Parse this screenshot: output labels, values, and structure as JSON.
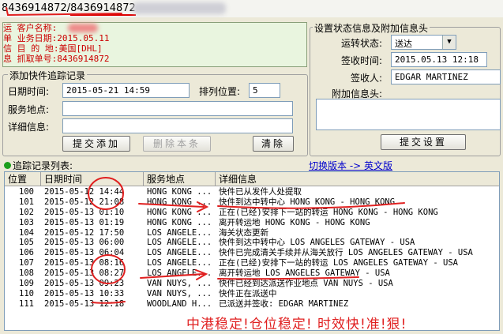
{
  "window": {
    "title_part1": "8436914872/",
    "title_part2": "8436914872"
  },
  "shipment_info": {
    "lines": [
      {
        "label": "运 客户名称:",
        "value": ""
      },
      {
        "label": "单 业务日期:",
        "value": "2015.05.11"
      },
      {
        "label": "信 目 的 地:",
        "value": "美国[DHL]"
      },
      {
        "label": "息 抓取单号:",
        "value": "8436914872"
      }
    ]
  },
  "add_record": {
    "group_title": "添加快件追踪记录",
    "date_label": "日期时间:",
    "date_value": "2015-05-21 14:59",
    "sort_label": "排列位置:",
    "sort_value": "5",
    "location_label": "服务地点:",
    "location_value": "",
    "detail_label": "详细信息:",
    "detail_value": "",
    "submit_button": "提交添加",
    "delete_button": "删除本条",
    "clear_button": "清除"
  },
  "status_panel": {
    "group_title": "设置状态信息及附加信息头",
    "status_label": "运转状态:",
    "status_value": "送达",
    "sign_time_label": "签收时间:",
    "sign_time_value": "2015.05.13 12:18",
    "signer_label": "签收人:",
    "signer_value": "EDGAR MARTINEZ",
    "header_label": "附加信息头:",
    "header_value": "",
    "submit_button": "提交设置"
  },
  "tracking_list": {
    "title": "追踪记录列表:",
    "switch_link": "切换版本 -> 英文版",
    "columns": [
      "位置",
      "日期时间",
      "服务地点",
      "详细信息"
    ],
    "rows": [
      [
        "100",
        "2015-05-12 14:44",
        "HONG KONG ...",
        "快件已从发件人处提取"
      ],
      [
        "101",
        "2015-05-12 21:08",
        "HONG KONG ...",
        "快件到达中转中心 HONG KONG - HONG KONG"
      ],
      [
        "102",
        "2015-05-13 01:10",
        "HONG KONG ...",
        "正在(已经)安排下一站的转运 HONG KONG - HONG KONG"
      ],
      [
        "103",
        "2015-05-13 01:19",
        "HONG KONG ...",
        "离开转运地 HONG KONG - HONG KONG"
      ],
      [
        "104",
        "2015-05-12 17:50",
        "LOS ANGELE...",
        "海关状态更新"
      ],
      [
        "105",
        "2015-05-13 06:00",
        "LOS ANGELE...",
        "快件到达中转中心 LOS ANGELES GATEWAY - USA"
      ],
      [
        "106",
        "2015-05-13 06:04",
        "LOS ANGELE...",
        "快件已完成清关手续并从海关放行 LOS ANGELES GATEWAY - USA"
      ],
      [
        "107",
        "2015-05-13 08:16",
        "LOS ANGELE...",
        "正在(已经)安排下一站的转运 LOS ANGELES GATEWAY - USA"
      ],
      [
        "108",
        "2015-05-13 08:27",
        "LOS ANGELE...",
        "离开转运地 LOS ANGELES GATEWAY - USA"
      ],
      [
        "109",
        "2015-05-13 09:23",
        "VAN NUYS, ...",
        "快件已经到达派送作业地点 VAN NUYS - USA"
      ],
      [
        "110",
        "2015-05-13 10:33",
        "VAN NUYS, ...",
        "快件正在派送中"
      ],
      [
        "111",
        "2015-05-13 12:18",
        "WOODLAND H...",
        "已派送并签收: EDGAR MARTINEZ"
      ]
    ]
  },
  "annotation": {
    "slogan": "中港稳定!仓位稳定! 时效快!准!狠!",
    "color": "#e02020"
  }
}
